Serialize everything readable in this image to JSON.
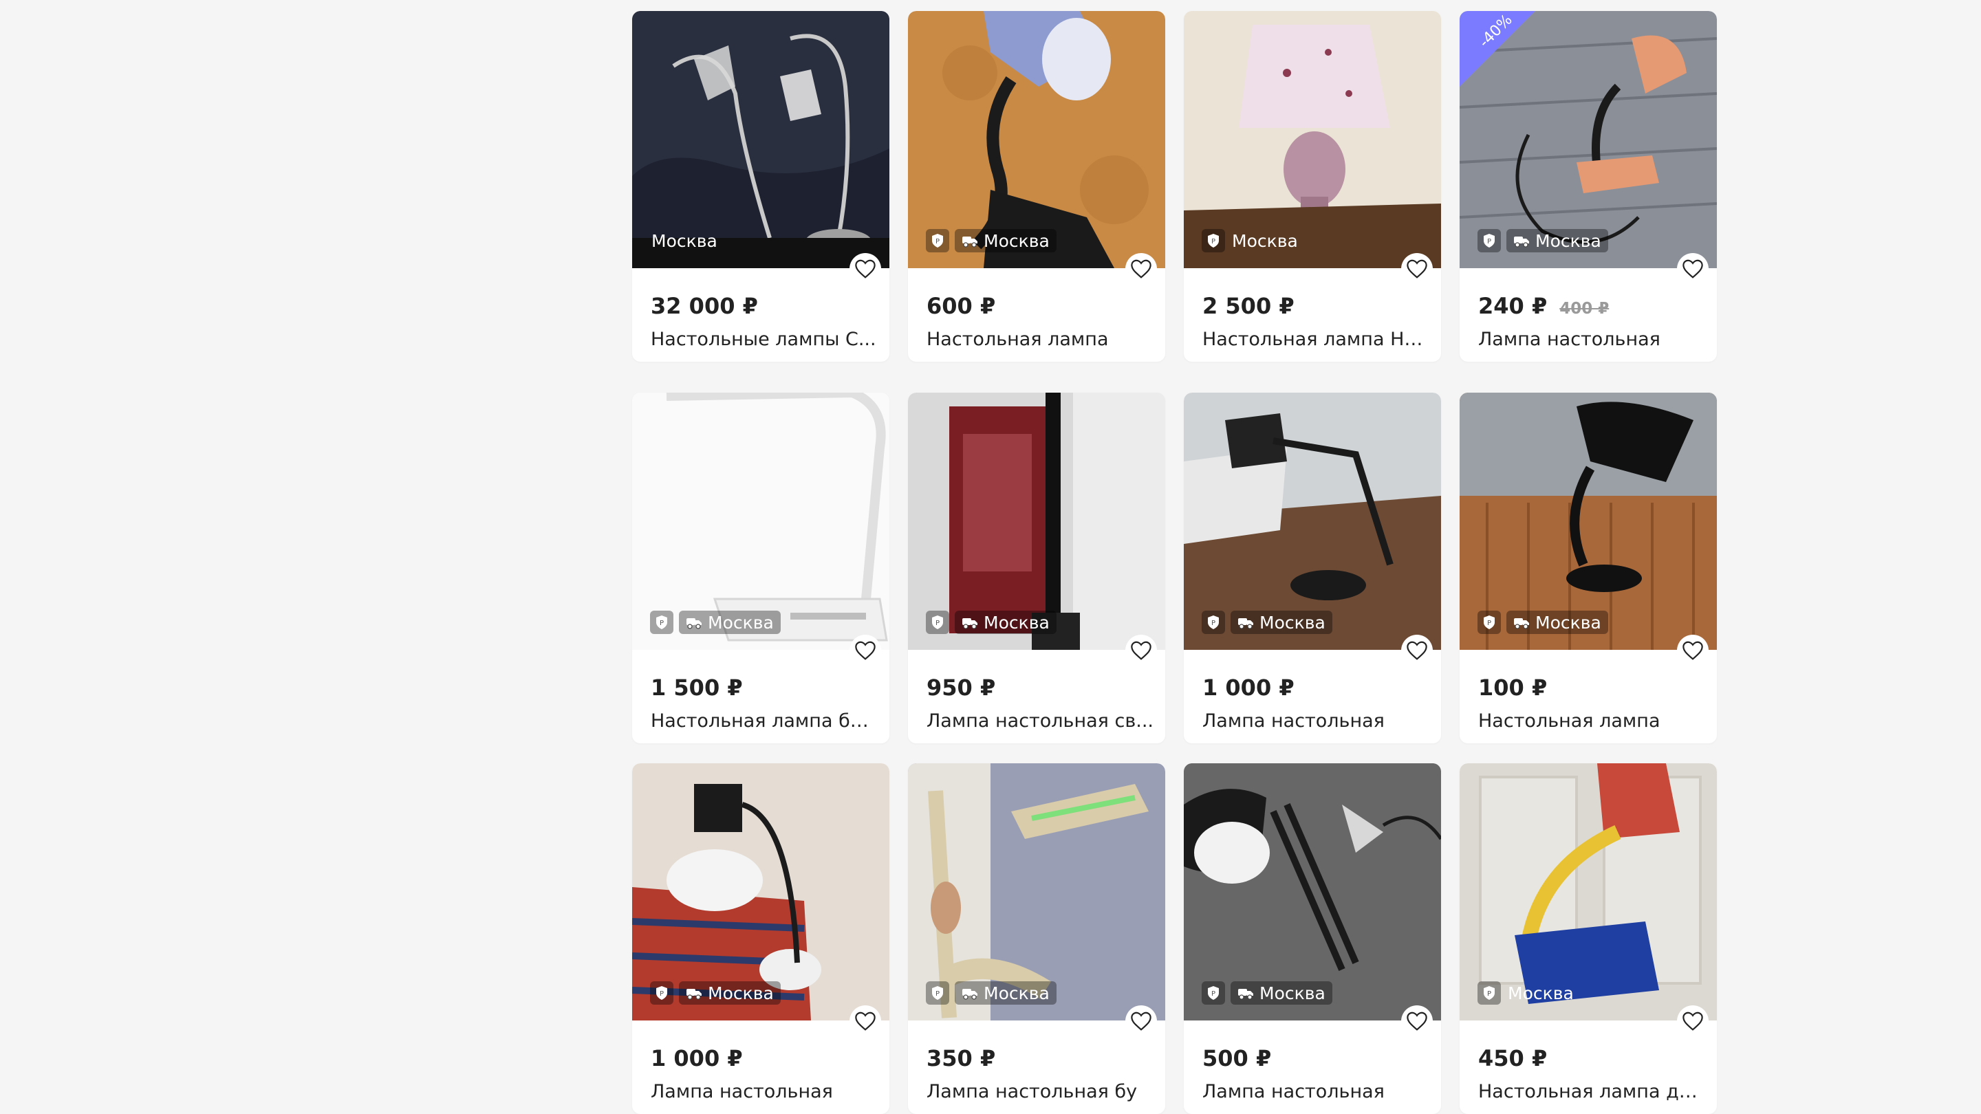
{
  "colors": {
    "background": "#f5f5f5",
    "card": "#ffffff",
    "text": "#222222",
    "discount_badge": "#7a7bff"
  },
  "listings": [
    {
      "price": "32 000 ₽",
      "old_price": "",
      "title": "Настольные лампы С...",
      "city": "Москва",
      "icons": [],
      "discount": ""
    },
    {
      "price": "600 ₽",
      "old_price": "",
      "title": "Настольная лампа",
      "city": "Москва",
      "icons": [
        "shield-icon",
        "delivery-truck-icon"
      ],
      "discount": ""
    },
    {
      "price": "2 500 ₽",
      "old_price": "",
      "title": "Настольная лампа Ни...",
      "city": "Москва",
      "icons": [
        "shield-icon"
      ],
      "discount": ""
    },
    {
      "price": "240 ₽",
      "old_price": "400 ₽",
      "title": "Лампа настольная",
      "city": "Москва",
      "icons": [
        "shield-icon",
        "delivery-truck-icon"
      ],
      "discount": "-40%"
    },
    {
      "price": "1 500 ₽",
      "old_price": "",
      "title": "Настольная лампа бе...",
      "city": "Москва",
      "icons": [
        "shield-icon",
        "delivery-truck-icon"
      ],
      "discount": ""
    },
    {
      "price": "950 ₽",
      "old_price": "",
      "title": "Лампа настольная св...",
      "city": "Москва",
      "icons": [
        "shield-icon",
        "delivery-truck-icon"
      ],
      "discount": ""
    },
    {
      "price": "1 000 ₽",
      "old_price": "",
      "title": "Лампа настольная",
      "city": "Москва",
      "icons": [
        "shield-icon",
        "delivery-truck-icon"
      ],
      "discount": ""
    },
    {
      "price": "100 ₽",
      "old_price": "",
      "title": "Настольная лампа",
      "city": "Москва",
      "icons": [
        "shield-icon",
        "delivery-truck-icon"
      ],
      "discount": ""
    },
    {
      "price": "1 000 ₽",
      "old_price": "",
      "title": "Лампа настольная",
      "city": "Москва",
      "icons": [
        "shield-icon",
        "delivery-truck-icon"
      ],
      "discount": ""
    },
    {
      "price": "350 ₽",
      "old_price": "",
      "title": "Лампа настольная бу",
      "city": "Москва",
      "icons": [
        "shield-icon",
        "delivery-truck-icon"
      ],
      "discount": ""
    },
    {
      "price": "500 ₽",
      "old_price": "",
      "title": "Лампа настольная",
      "city": "Москва",
      "icons": [
        "shield-icon",
        "delivery-truck-icon"
      ],
      "discount": ""
    },
    {
      "price": "450 ₽",
      "old_price": "",
      "title": "Настольная лампа дл...",
      "city": "Москва",
      "icons": [
        "shield-icon"
      ],
      "discount": ""
    }
  ]
}
